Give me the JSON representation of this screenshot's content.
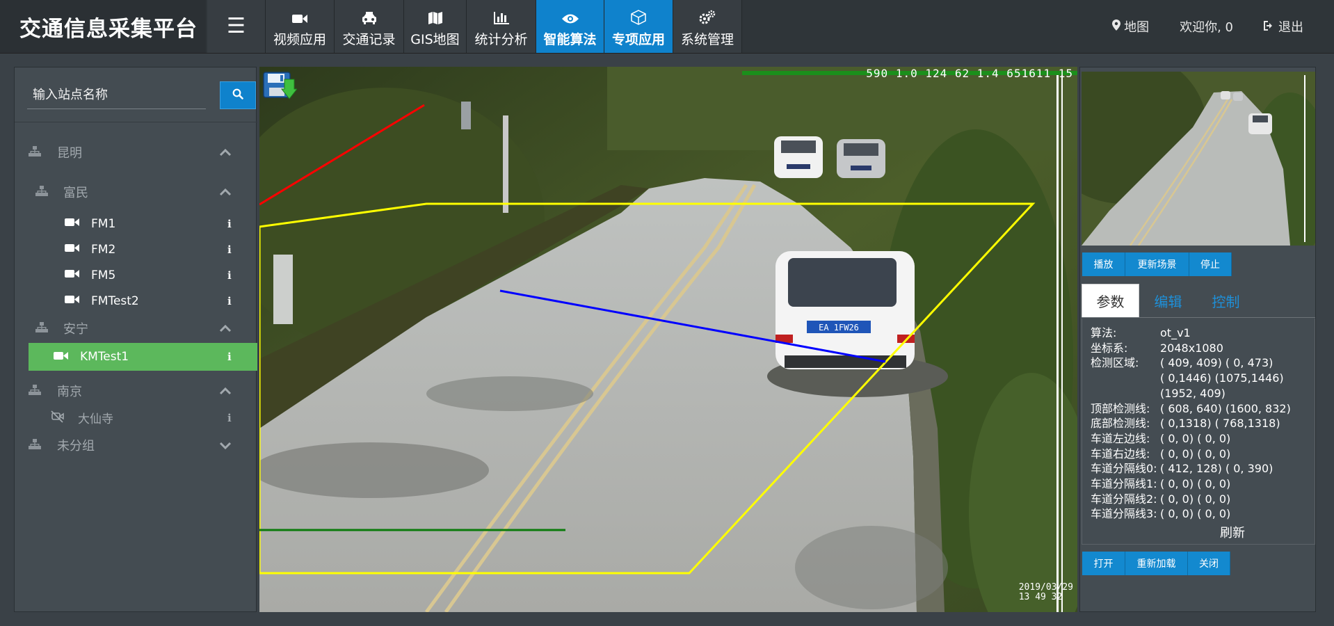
{
  "brand": {
    "title": "交通信息采集平台"
  },
  "nav": {
    "items": [
      {
        "label": "视频应用",
        "icon": "video-camera-icon",
        "active": false
      },
      {
        "label": "交通记录",
        "icon": "car-icon",
        "active": false
      },
      {
        "label": "GIS地图",
        "icon": "map-icon",
        "active": false
      },
      {
        "label": "统计分析",
        "icon": "bar-chart-icon",
        "active": false
      },
      {
        "label": "智能算法",
        "icon": "eye-icon",
        "active": true
      },
      {
        "label": "专项应用",
        "icon": "cube-icon",
        "active": true
      },
      {
        "label": "系统管理",
        "icon": "gears-icon",
        "active": false
      }
    ]
  },
  "topright": {
    "map_label": "地图",
    "welcome": "欢迎你, 0",
    "logout": "退出"
  },
  "sidebar": {
    "search_placeholder": "输入站点名称",
    "groups": {
      "kunming": "昆明",
      "fumin": "富民",
      "anning": "安宁",
      "nanjing": "南京",
      "ungrouped": "未分组"
    },
    "stations": {
      "fm1": "FM1",
      "fm2": "FM2",
      "fm5": "FM5",
      "fmtest2": "FMTest2",
      "kmtest1": "KMTest1",
      "daxiansi": "大仙寺"
    }
  },
  "video": {
    "osd_top": "590 1.0 124 62 1.4 651611 15",
    "osd_date": "2019/03/29",
    "osd_time": "13 49 32",
    "plate": "EA 1FW26"
  },
  "right": {
    "play_buttons": [
      "播放",
      "更新场景",
      "停止"
    ],
    "tabs": [
      "参数",
      "编辑",
      "控制"
    ],
    "params": [
      {
        "k": "算法:",
        "v": "ot_v1"
      },
      {
        "k": "坐标系:",
        "v": "2048x1080"
      },
      {
        "k": "检测区域:",
        "v": "( 409, 409) ( 0, 473)"
      },
      {
        "k": "",
        "v": "( 0,1446) (1075,1446)"
      },
      {
        "k": "",
        "v": "(1952, 409)"
      },
      {
        "k": "顶部检测线:",
        "v": "( 608, 640) (1600, 832)"
      },
      {
        "k": "底部检测线:",
        "v": "( 0,1318) ( 768,1318)"
      },
      {
        "k": "车道左边线:",
        "v": "( 0, 0) ( 0, 0)"
      },
      {
        "k": "车道右边线:",
        "v": "( 0, 0) ( 0, 0)"
      },
      {
        "k": "车道分隔线0:",
        "v": "( 412, 128) ( 0, 390)"
      },
      {
        "k": "车道分隔线1:",
        "v": "( 0, 0) ( 0, 0)"
      },
      {
        "k": "车道分隔线2:",
        "v": "( 0, 0) ( 0, 0)"
      },
      {
        "k": "车道分隔线3:",
        "v": "( 0, 0) ( 0, 0)"
      }
    ],
    "refresh": "刷新",
    "file_buttons": [
      "打开",
      "重新加载",
      "关闭"
    ]
  },
  "colors": {
    "accent": "#0f82cc",
    "selected": "#5cb85c",
    "zone": "#ffff00",
    "top_line": "#0000ff",
    "bottom_line": "#0a7a0a",
    "lane_line": "#ff0000"
  }
}
